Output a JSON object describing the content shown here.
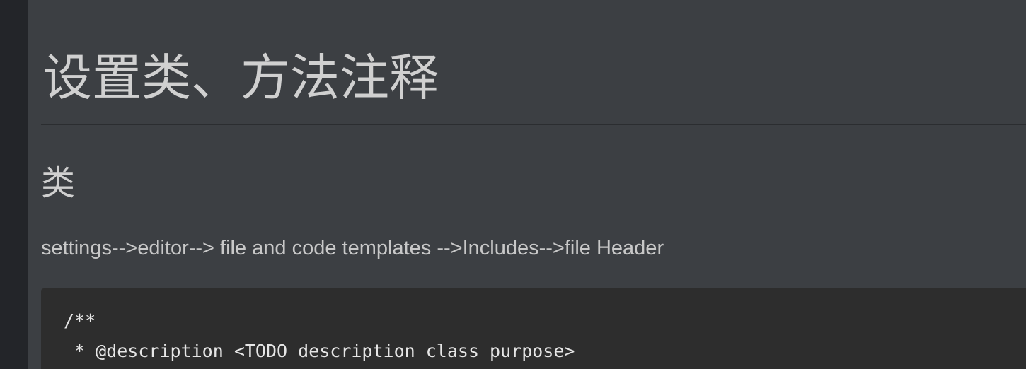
{
  "article": {
    "title": "设置类、方法注释",
    "section_heading": "类",
    "path_text": "settings-->editor--> file and code templates -->Includes-->file Header",
    "code_lines": [
      "/**",
      " * @description <TODO description class purpose>"
    ]
  },
  "colors": {
    "page_background": "#3c3f43",
    "sidebar_strip": "#232529",
    "code_background": "#2d2d2d",
    "text": "#d0d0d0"
  }
}
